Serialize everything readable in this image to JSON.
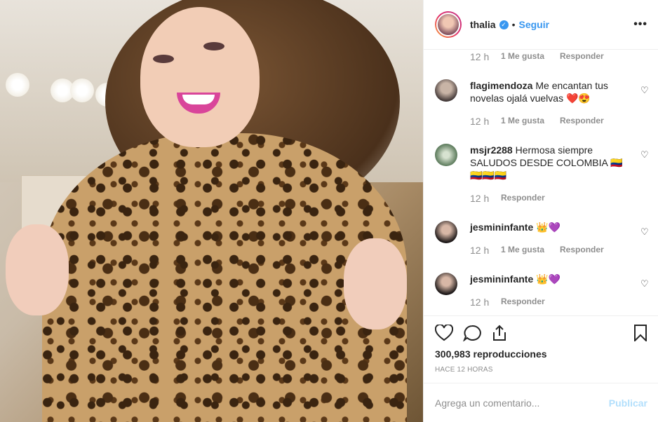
{
  "post": {
    "username": "thalia",
    "verified_mark": "✓",
    "separator": "•",
    "follow_label": "Seguir",
    "more_icon": "more-icon"
  },
  "comments": [
    {
      "time": "12 h",
      "likes": "1 Me gusta",
      "reply": "Responder"
    },
    {
      "user": "flagimendoza",
      "text": "Me encantan tus novelas ojalá vuelvas ❤️😍",
      "time": "12 h",
      "likes": "1 Me gusta",
      "reply": "Responder"
    },
    {
      "user": "msjr2288",
      "text": "Hermosa siempre SALUDOS DESDE COLOMBIA 🇨🇴🇨🇴🇨🇴🇨🇴",
      "time": "12 h",
      "likes": "",
      "reply": "Responder"
    },
    {
      "user": "jesmininfante",
      "text": "👑💜",
      "time": "12 h",
      "likes": "1 Me gusta",
      "reply": "Responder"
    },
    {
      "user": "jesmininfante",
      "text": "👑💜",
      "time": "12 h",
      "likes": "",
      "reply": "Responder"
    }
  ],
  "actions": {
    "views": "300,983 reproducciones",
    "ago": "HACE 12 HORAS"
  },
  "add_comment": {
    "placeholder": "Agrega un comentario...",
    "publish_label": "Publicar"
  },
  "colors": {
    "link_blue": "#3897f0",
    "publish_disabled": "#b2dffc",
    "muted": "#8e8e8e"
  }
}
